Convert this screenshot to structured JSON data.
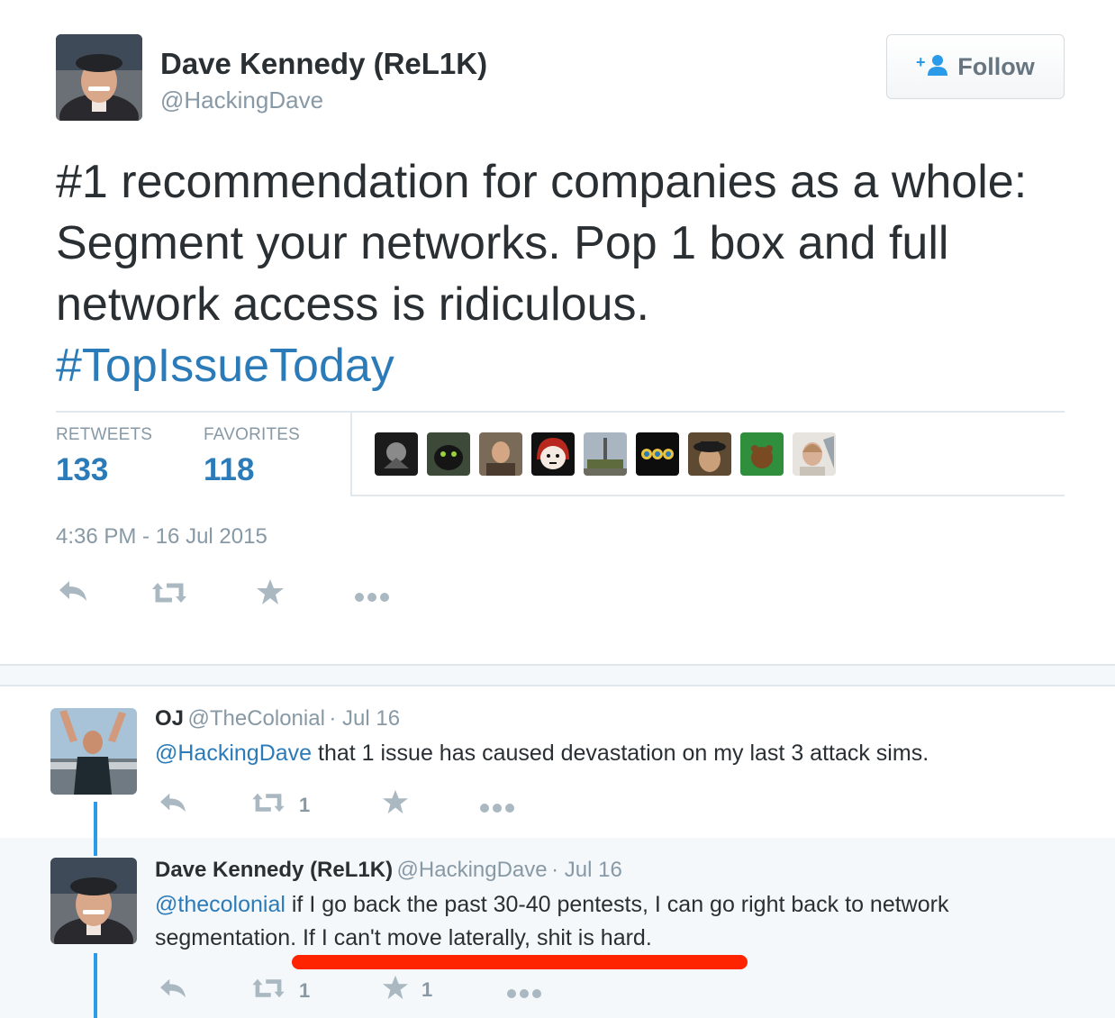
{
  "tweet": {
    "author_name": "Dave Kennedy (ReL1K)",
    "author_handle": "@HackingDave",
    "follow_label": "Follow",
    "text": "#1 recommendation for companies as a whole: Segment your networks. Pop 1 box and full network access is ridiculous.",
    "hashtag": "#TopIssueToday",
    "stats": {
      "retweets_label": "RETWEETS",
      "retweets_value": "133",
      "favorites_label": "FAVORITES",
      "favorites_value": "118"
    },
    "favoriter_avatar_count": 9,
    "timestamp": "4:36 PM - 16 Jul 2015",
    "actions": [
      "reply-icon",
      "retweet-icon",
      "favorite-star-icon",
      "more-dots-icon"
    ]
  },
  "replies": [
    {
      "name": "OJ",
      "handle": "@TheColonial",
      "date": "· Jul 16",
      "mention": "@HackingDave",
      "text": " that 1 issue has caused devastation on my last 3 attack sims.",
      "retweet_count": "1",
      "favorite_count": ""
    },
    {
      "name": "Dave Kennedy (ReL1K)",
      "handle": "@HackingDave",
      "date": "· Jul 16",
      "mention": "@thecolonial",
      "text_line1": " if I go back the past 30-40 pentests, I can go right back to network",
      "text_line2": "segmentation. If I can't move laterally, shit is hard.",
      "retweet_count": "1",
      "favorite_count": "1"
    }
  ],
  "colors": {
    "link_blue": "#2b7bb9",
    "thread_line": "#2b9ae8",
    "muted_gray": "#8899a6",
    "annotation_red": "#ff2400"
  }
}
